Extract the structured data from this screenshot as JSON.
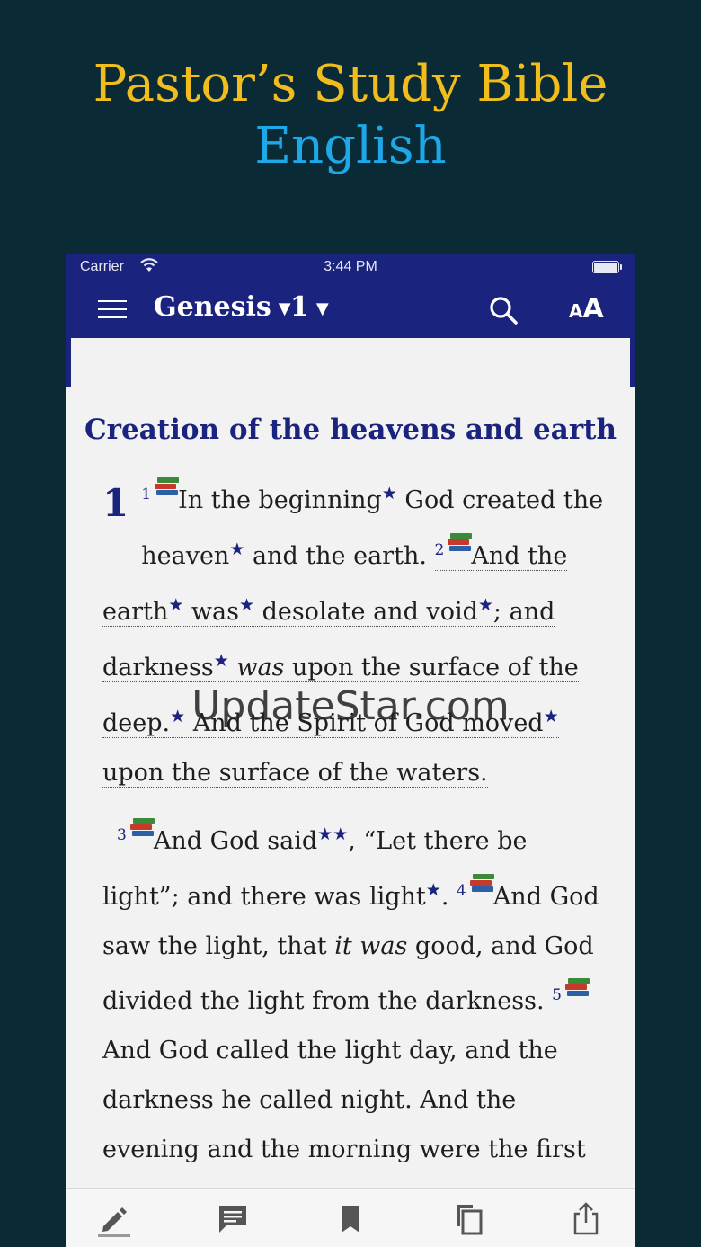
{
  "promo": {
    "line1": "Pastor’s Study Bible",
    "line2": "English"
  },
  "status_bar": {
    "carrier": "Carrier",
    "time": "3:44 PM"
  },
  "navbar": {
    "book": "Genesis",
    "chapter": "1",
    "caret": "▼"
  },
  "content": {
    "section_title": "Creation of the heavens and earth",
    "chapter_number": "1",
    "verses": {
      "v1": {
        "num": "1",
        "text_a": "In the beginning",
        "text_b": " God created the heaven",
        "text_c": " and the earth. "
      },
      "v2": {
        "num": "2",
        "text_a": "And the earth",
        "text_b": " was",
        "text_c": " desolate and void",
        "text_d": "; and darkness",
        "text_e": "was",
        "text_f": " upon the surface of the deep.",
        "text_g": " And the Spirit of God moved",
        "text_h": " upon the surface of the waters."
      },
      "v3": {
        "num": "3",
        "text_a": "And God said",
        "text_b": ", “Let there be light”; and there was light",
        "text_c": ". "
      },
      "v4": {
        "num": "4",
        "text_a": "And God saw the light, that ",
        "text_b": "it was",
        "text_c": " good, and God divided the light from the darkness. "
      },
      "v5": {
        "num": "5",
        "text_a": "And God called the light day, and the darkness he called night. And the evening and the morning were the first day."
      }
    },
    "star": "★",
    "double_star": "★★"
  },
  "watermark": "UpdateStar.com",
  "colors": {
    "background": "#0a2b36",
    "title_gold": "#f0bd1c",
    "title_blue": "#1ea8e8",
    "navbar": "#1a237e"
  },
  "tabbar": {
    "icons": [
      "pencil-icon",
      "comment-icon",
      "bookmark-icon",
      "copy-icon",
      "share-icon"
    ]
  }
}
